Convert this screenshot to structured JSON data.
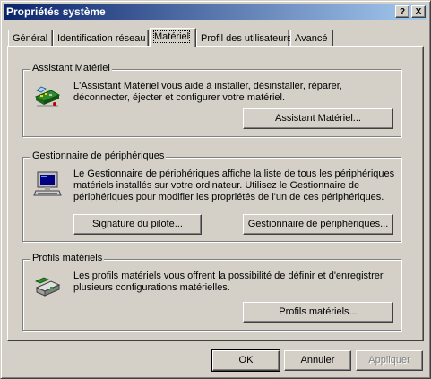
{
  "window": {
    "title": "Propriétés système",
    "help_label": "?",
    "close_label": "X"
  },
  "tabs": [
    {
      "label": "Général"
    },
    {
      "label": "Identification réseau"
    },
    {
      "label": "Matériel"
    },
    {
      "label": "Profil des utilisateurs"
    },
    {
      "label": "Avancé"
    }
  ],
  "active_tab": "Matériel",
  "sections": {
    "wizard": {
      "label": "Assistant Matériel",
      "description": "L'Assistant Matériel vous aide à installer, désinstaller, réparer, déconnecter, éjecter et configurer votre matériel.",
      "button": "Assistant Matériel...",
      "icon": "hardware-wizard-icon"
    },
    "device_manager": {
      "label": "Gestionnaire de périphériques",
      "description": "Le Gestionnaire de périphériques affiche la liste de tous les périphériques matériels installés sur votre ordinateur. Utilisez le Gestionnaire de périphériques pour modifier les propriétés de l'un de ces périphériques.",
      "button_signature": "Signature du pilote...",
      "button_manager": "Gestionnaire de périphériques...",
      "icon": "computer-icon"
    },
    "profiles": {
      "label": "Profils matériels",
      "description": "Les profils matériels vous offrent la possibilité de définir et d'enregistrer plusieurs configurations matérielles.",
      "button": "Profils matériels...",
      "icon": "hardware-profile-icon"
    }
  },
  "footer": {
    "ok": "OK",
    "cancel": "Annuler",
    "apply": "Appliquer"
  }
}
